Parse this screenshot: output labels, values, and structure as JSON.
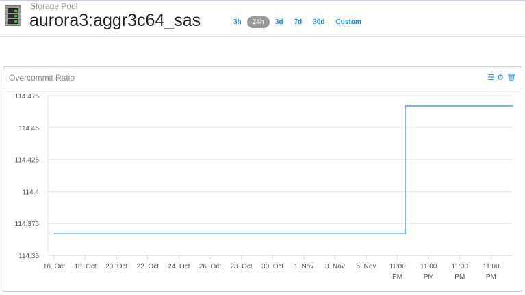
{
  "header": {
    "subtitle": "Storage Pool",
    "title": "aurora3:aggr3c64_sas",
    "ranges": [
      "3h",
      "24h",
      "3d",
      "7d",
      "30d",
      "Custom"
    ],
    "active_range": "24h"
  },
  "panel": {
    "title": "Overcommit Ratio",
    "icons": [
      "list-icon",
      "gear-icon",
      "trash-icon"
    ]
  },
  "colors": {
    "accent": "#1e8bd3",
    "line": "#5b9bd5"
  },
  "chart_data": {
    "type": "line",
    "title": "Overcommit Ratio",
    "y_ticks": [
      "114.35",
      "114.375",
      "114.4",
      "114.425",
      "114.45",
      "114.475"
    ],
    "ylim": [
      114.35,
      114.475
    ],
    "x_ticks": [
      [
        "16. Oct"
      ],
      [
        "18. Oct"
      ],
      [
        "20. Oct"
      ],
      [
        "22. Oct"
      ],
      [
        "24. Oct"
      ],
      [
        "26. Oct"
      ],
      [
        "28. Oct"
      ],
      [
        "30. Oct"
      ],
      [
        "1. Nov"
      ],
      [
        "3. Nov"
      ],
      [
        "5. Nov"
      ],
      [
        "11:00",
        "PM"
      ],
      [
        "11:00",
        "PM"
      ],
      [
        "11:00",
        "PM"
      ],
      [
        "11:00",
        "PM"
      ]
    ],
    "series": [
      {
        "name": "Overcommit Ratio",
        "points": [
          [
            0,
            114.367
          ],
          [
            11.25,
            114.367
          ],
          [
            11.25,
            114.467
          ],
          [
            14.7,
            114.467
          ]
        ]
      }
    ]
  }
}
